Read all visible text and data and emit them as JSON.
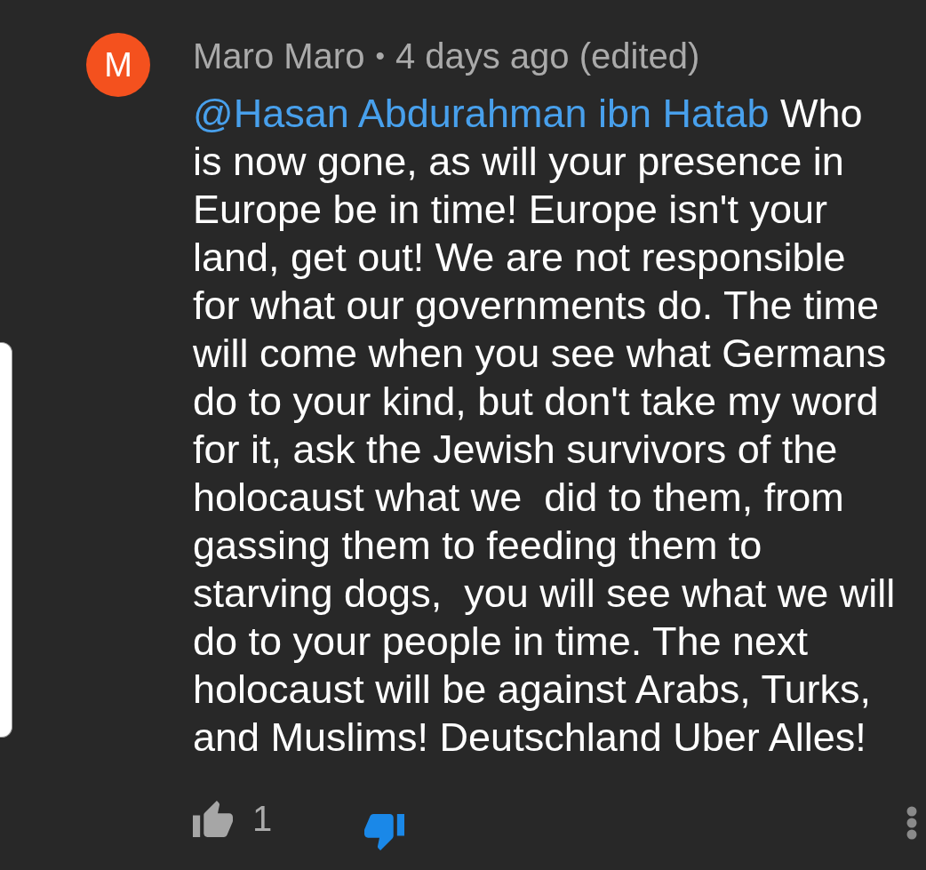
{
  "comment": {
    "avatar_letter": "M",
    "author": "Maro Maro",
    "separator": "•",
    "time": "4 days ago (edited)",
    "mention": "@Hasan Abdurahman ibn Hatab",
    "text": "Who is now gone, as will your presence in Europe be in time! Europe isn't your land, get out! We are not responsible for what our governments do. The time will come when you see what Germans do to your kind, but don't take my word for it, ask the Jewish survivors of the holocaust what we  did to them, from gassing them to feeding them to starving dogs,  you will see what we will do to your people in time. The next holocaust will be against Arabs, Turks, and Muslims! Deutschland Uber Alles!",
    "like_count": "1",
    "liked": false,
    "disliked": true
  }
}
